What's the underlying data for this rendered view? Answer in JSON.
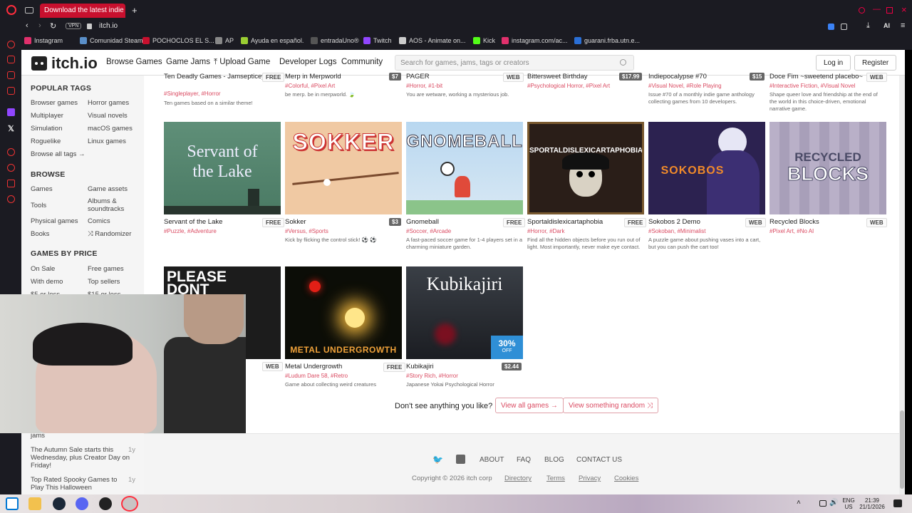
{
  "browser": {
    "tab_title": "Download the latest indie g",
    "url": "itch.io",
    "vpn_label": "VPN",
    "ai_label": "AI",
    "bookmarks": [
      {
        "label": "Instagram",
        "color": "#e1306c"
      },
      {
        "label": "Comunidad Steam...",
        "color": "#1b2838"
      },
      {
        "label": "POCHOCLOS EL S...",
        "color": "#c8102e"
      },
      {
        "label": "AP",
        "color": "#888888"
      },
      {
        "label": "Ayuda en español.",
        "color": "#9acd32"
      },
      {
        "label": "entradaUno®",
        "color": "#555555"
      },
      {
        "label": "Twitch",
        "color": "#9146ff"
      },
      {
        "label": "AOS - Animate on...",
        "color": "#cccccc"
      },
      {
        "label": "Kick",
        "color": "#53fc18"
      },
      {
        "label": "instagram.com/ac...",
        "color": "#e1306c"
      },
      {
        "label": "guarani.frba.utn.e...",
        "color": "#2a6fd6"
      }
    ]
  },
  "header": {
    "logo": "itch.io",
    "nav": [
      "Browse Games",
      "Game Jams",
      "Upload Game",
      "Developer Logs",
      "Community"
    ],
    "search_placeholder": "Search for games, jams, tags or creators",
    "login": "Log in",
    "register": "Register"
  },
  "sidebar": {
    "popular_tags_title": "POPULAR TAGS",
    "popular_tags": [
      "Browser games",
      "Horror games",
      "Multiplayer",
      "Visual novels",
      "Simulation",
      "macOS games",
      "Roguelike",
      "Linux games",
      "Browse all tags →"
    ],
    "browse_title": "BROWSE",
    "browse": [
      "Games",
      "Game assets",
      "Tools",
      "Albums & soundtracks",
      "Physical games",
      "Comics",
      "Books",
      "Randomizer"
    ],
    "price_title": "GAMES BY PRICE",
    "price": [
      "On Sale",
      "Free games",
      "With demo",
      "Top sellers",
      "$5 or less",
      "$15 or less"
    ],
    "news_tail": "jams",
    "news": [
      {
        "text": "The Autumn Sale starts this Wednesday, plus Creator Day on Friday!",
        "age": "1y"
      },
      {
        "text": "Top Rated Spooky Games to Play This Halloween",
        "age": "1y"
      }
    ]
  },
  "row0": [
    {
      "title": "Ten Deadly Games - Jamsepticeye",
      "price": "FREE",
      "tags": "#Singleplayer, #Horror",
      "desc": "Ten games based on a similar theme!"
    },
    {
      "title": "Merp in Merpworld",
      "price": "$7",
      "tags": "#Colorful, #Pixel Art",
      "desc": "be merp. be in merpworld. 🍃"
    },
    {
      "title": "PAGER",
      "price": "WEB",
      "tags": "#Horror, #1-bit",
      "desc": "You are wetware, working a mysterious job."
    },
    {
      "title": "Bittersweet Birthday",
      "price": "$17.99",
      "tags": "#Psychological Horror, #Pixel Art",
      "desc": ""
    },
    {
      "title": "Indiepocalypse #70",
      "price": "$15",
      "tags": "#Visual Novel, #Role Playing",
      "desc": "Issue #70 of a monthly indie game anthology collecting games from 10 developers."
    },
    {
      "title": "Doce Fim ~sweetend placebo~",
      "price": "WEB",
      "tags": "#Interactive Fiction, #Visual Novel",
      "desc": "Shape queer love and friendship at the end of the world in this choice-driven, emotional narrative game."
    }
  ],
  "row1": [
    {
      "title": "Servant of the Lake",
      "price": "FREE",
      "tags": "#Puzzle, #Adventure",
      "desc": "",
      "art": "Servant of the Lake"
    },
    {
      "title": "Sokker",
      "price": "$3",
      "tags": "#Versus, #Sports",
      "desc": "Kick by flicking the control stick! ⚽ ⚽",
      "art": "SOKKER"
    },
    {
      "title": "Gnomeball",
      "price": "FREE",
      "tags": "#Soccer, #Arcade",
      "desc": "A fast-paced soccer game for 1-4 players set in a charming miniature garden.",
      "art": "GNOMEBALL"
    },
    {
      "title": "Sportaldislexicartaphobia",
      "price": "FREE",
      "tags": "#Horror, #Dark",
      "desc": "Find all the hidden objects before you run out of light. Most importantly, never make eye contact.",
      "art": "SPORTALDISLEXICARTAPHOBIA"
    },
    {
      "title": "Sokobos 2 Demo",
      "price": "WEB",
      "tags": "#Sokoban, #Minimalist",
      "desc": "A puzzle game about pushing vases into a cart, but you can push the cart too!",
      "art": "SOKOBOS"
    },
    {
      "title": "Recycled Blocks",
      "price": "WEB",
      "tags": "#Pixel Art, #No AI",
      "desc": "",
      "art_line1": "RECYCLED",
      "art_line2": "BLOCKS"
    }
  ],
  "row2": [
    {
      "title": "",
      "price": "WEB",
      "tags": "",
      "desc": "",
      "art": "PLEASE DONT"
    },
    {
      "title": "Metal Undergrowth",
      "price": "FREE",
      "tags": "#Ludum Dare 58, #Retro",
      "desc": "Game about collecting weird creatures",
      "art": "METAL UNDERGROWTH"
    },
    {
      "title": "Kubikajiri",
      "price": "$2.44",
      "tags": "#Story Rich, #Horror",
      "desc": "Japanese Yokai Psychological Horror",
      "art": "Kubikajiri",
      "discount": "30%",
      "discount_sub": "OFF"
    }
  ],
  "cta": {
    "question": "Don't see anything you like?",
    "view_all": "View all games →",
    "random": "View something random ⤨"
  },
  "footer": {
    "links": [
      "ABOUT",
      "FAQ",
      "BLOG",
      "CONTACT US"
    ],
    "copyright": "Copyright © 2026 itch corp",
    "legal": [
      "Directory",
      "Terms",
      "Privacy",
      "Cookies"
    ]
  },
  "taskbar": {
    "lang1": "ENG",
    "lang2": "US",
    "time": "21:39",
    "date": "21/1/2026"
  },
  "colors": {
    "accent": "#da4a61",
    "brand": "#fa5c5c",
    "opera": "#c8102e"
  }
}
